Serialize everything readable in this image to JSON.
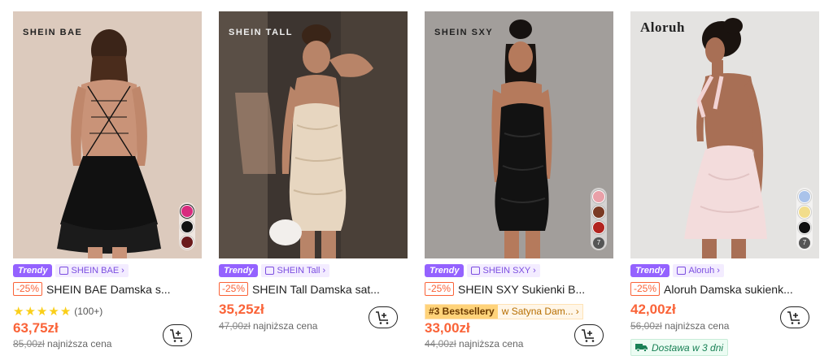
{
  "products": [
    {
      "brand_logo": "SHEIN BAE",
      "trendy_label": "Trendy",
      "store_name": "SHEIN BAE",
      "discount": "-25%",
      "title": "SHEIN BAE Damska s...",
      "rating_count": "(100+)",
      "price": "63,75zł",
      "old_price": "85,00zł",
      "lowest_price_label": "najniższa cena",
      "swatch_colors": [
        "#d82a7e",
        "#111111",
        "#6a1a1c"
      ]
    },
    {
      "brand_logo": "SHEIN TALL",
      "trendy_label": "Trendy",
      "store_name": "SHEIN Tall",
      "discount": "-25%",
      "title": "SHEIN Tall Damska sat...",
      "price": "35,25zł",
      "old_price": "47,00zł",
      "lowest_price_label": "najniższa cena"
    },
    {
      "brand_logo": "SHEIN SXY",
      "trendy_label": "Trendy",
      "store_name": "SHEIN SXY",
      "discount": "-25%",
      "title": "SHEIN SXY Sukienki B...",
      "bestseller_rank": "#3 Bestsellery",
      "bestseller_where": "w Satyna Dam...",
      "price": "33,00zł",
      "old_price": "44,00zł",
      "lowest_price_label": "najniższa cena",
      "swatch_colors": [
        "#e9a0a8",
        "#7a3a24",
        "#b22420"
      ],
      "swatch_count": "7"
    },
    {
      "brand_logo": "Aloruh",
      "trendy_label": "Trendy",
      "store_name": "Aloruh",
      "discount": "-25%",
      "title": "Aloruh Damska sukienk...",
      "price": "42,00zł",
      "old_price": "56,00zł",
      "lowest_price_label": "najniższa cena",
      "delivery_label": "Dostawa w 3 dni",
      "swatch_colors": [
        "#aac3ea",
        "#f2dd8c",
        "#111111"
      ],
      "swatch_count": "7"
    }
  ],
  "colors": {
    "accent_price": "#fa6338",
    "trendy": "#9462ff",
    "delivery_green": "#198055"
  }
}
